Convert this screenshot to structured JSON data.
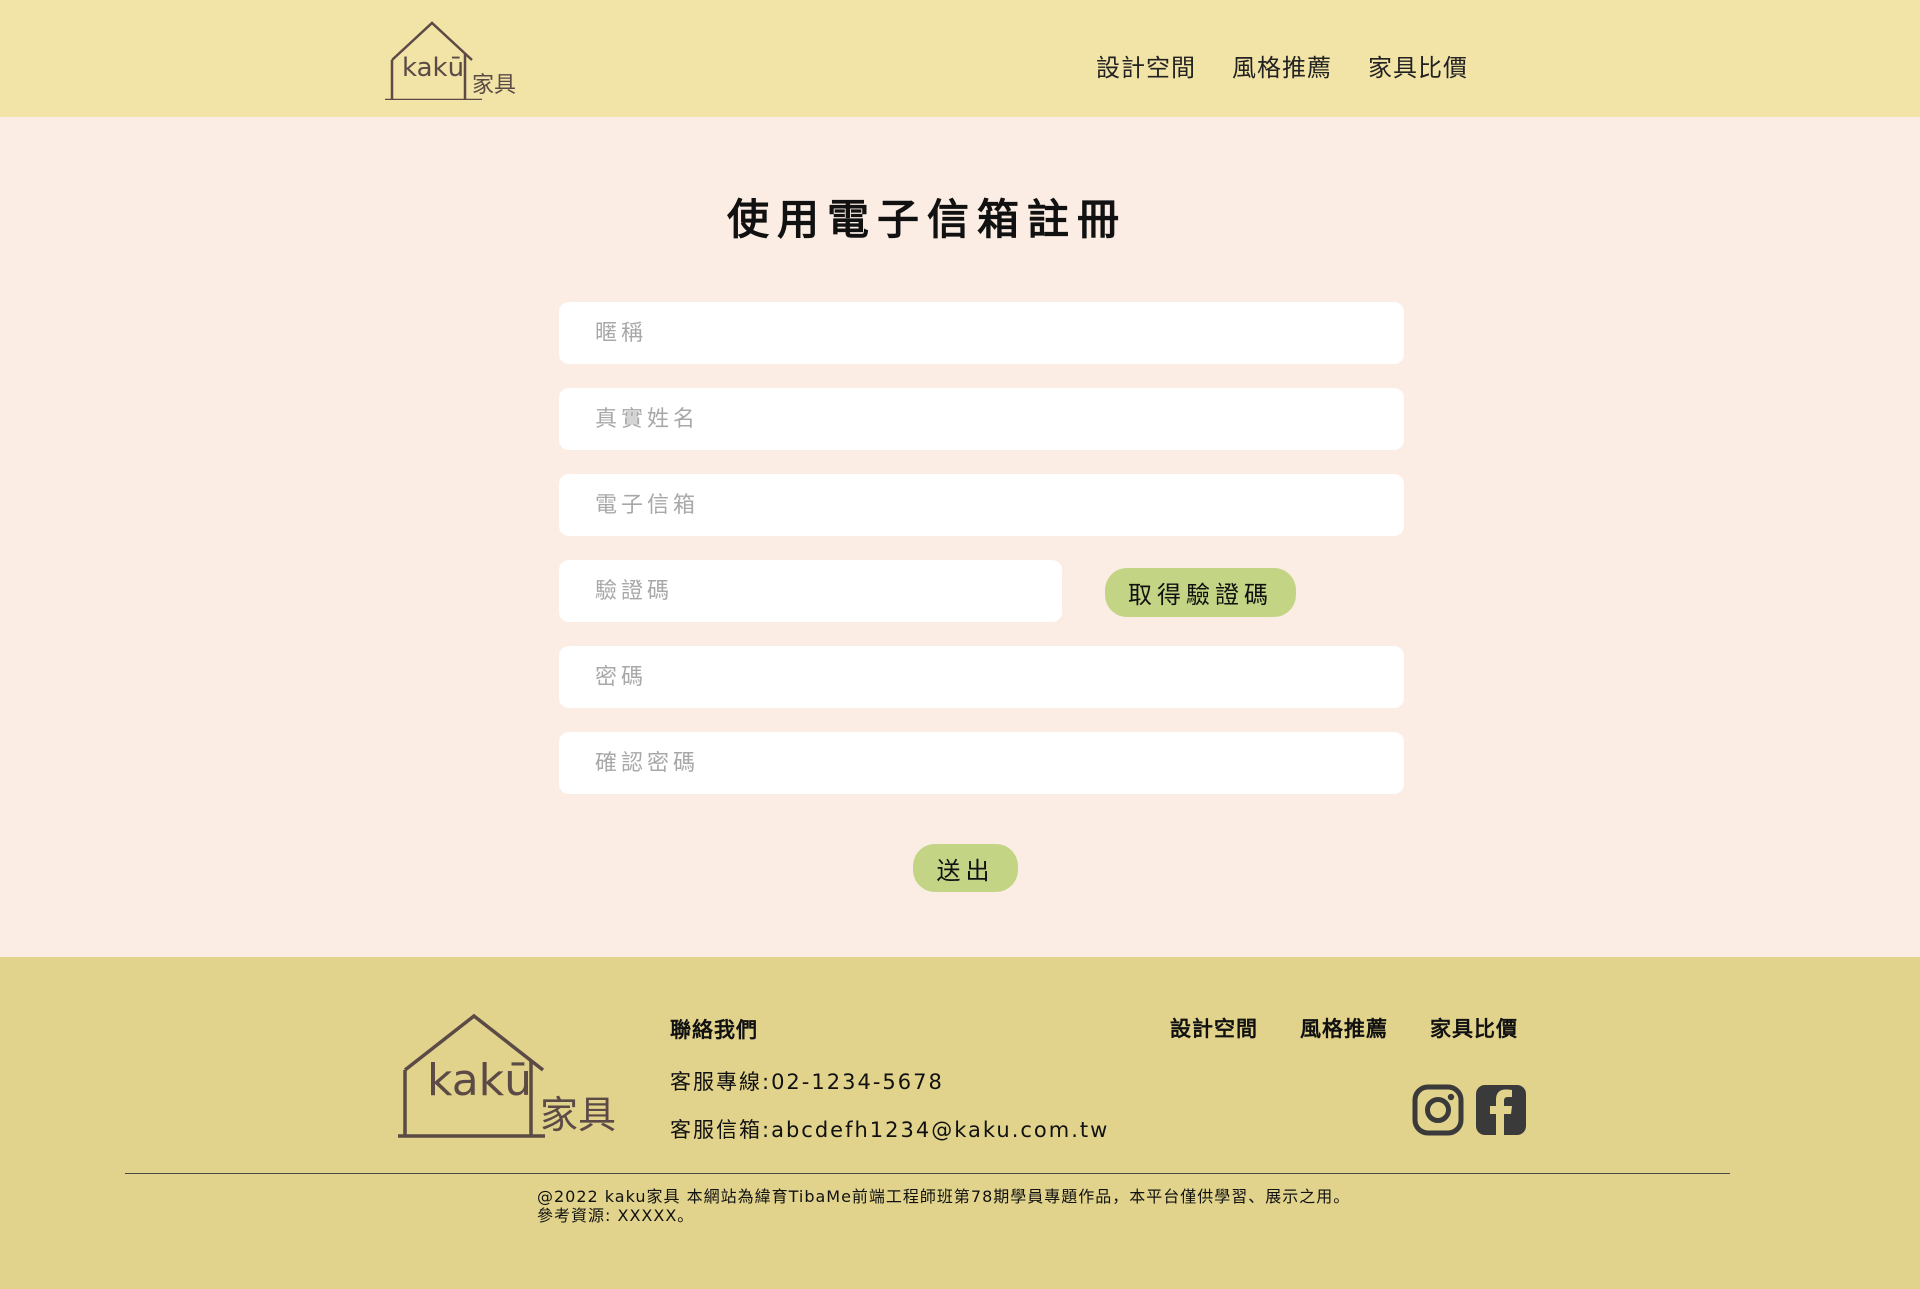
{
  "header": {
    "logo_text": "kakū",
    "logo_subtext": "家具",
    "nav": [
      "設計空間",
      "風格推薦",
      "家具比價"
    ]
  },
  "form": {
    "title": "使用電子信箱註冊",
    "nickname_placeholder": "暱稱",
    "realname_placeholder": "真實姓名",
    "email_placeholder": "電子信箱",
    "code_placeholder": "驗證碼",
    "get_code_label": "取得驗證碼",
    "password_placeholder": "密碼",
    "confirm_password_placeholder": "確認密碼",
    "submit_label": "送出"
  },
  "footer": {
    "logo_text": "kakū",
    "logo_subtext": "家具",
    "contact_title": "聯絡我們",
    "phone": "客服專線:02-1234-5678",
    "email": "客服信箱:abcdefh1234@kaku.com.tw",
    "nav": [
      "設計空間",
      "風格推薦",
      "家具比價"
    ],
    "social": [
      "instagram-icon",
      "facebook-icon"
    ],
    "copyright_line1": "@2022 kaku家具 本網站為緯育TibaMe前端工程師班第78期學員專題作品，本平台僅供學習、展示之用。",
    "copyright_line2": "參考資源: XXXXX。"
  },
  "colors": {
    "header_bg": "#f2e3a7",
    "page_bg": "#fcede4",
    "footer_bg": "#e1d38c",
    "button_bg": "#c3d485",
    "logo_brown": "#5b4a45"
  }
}
